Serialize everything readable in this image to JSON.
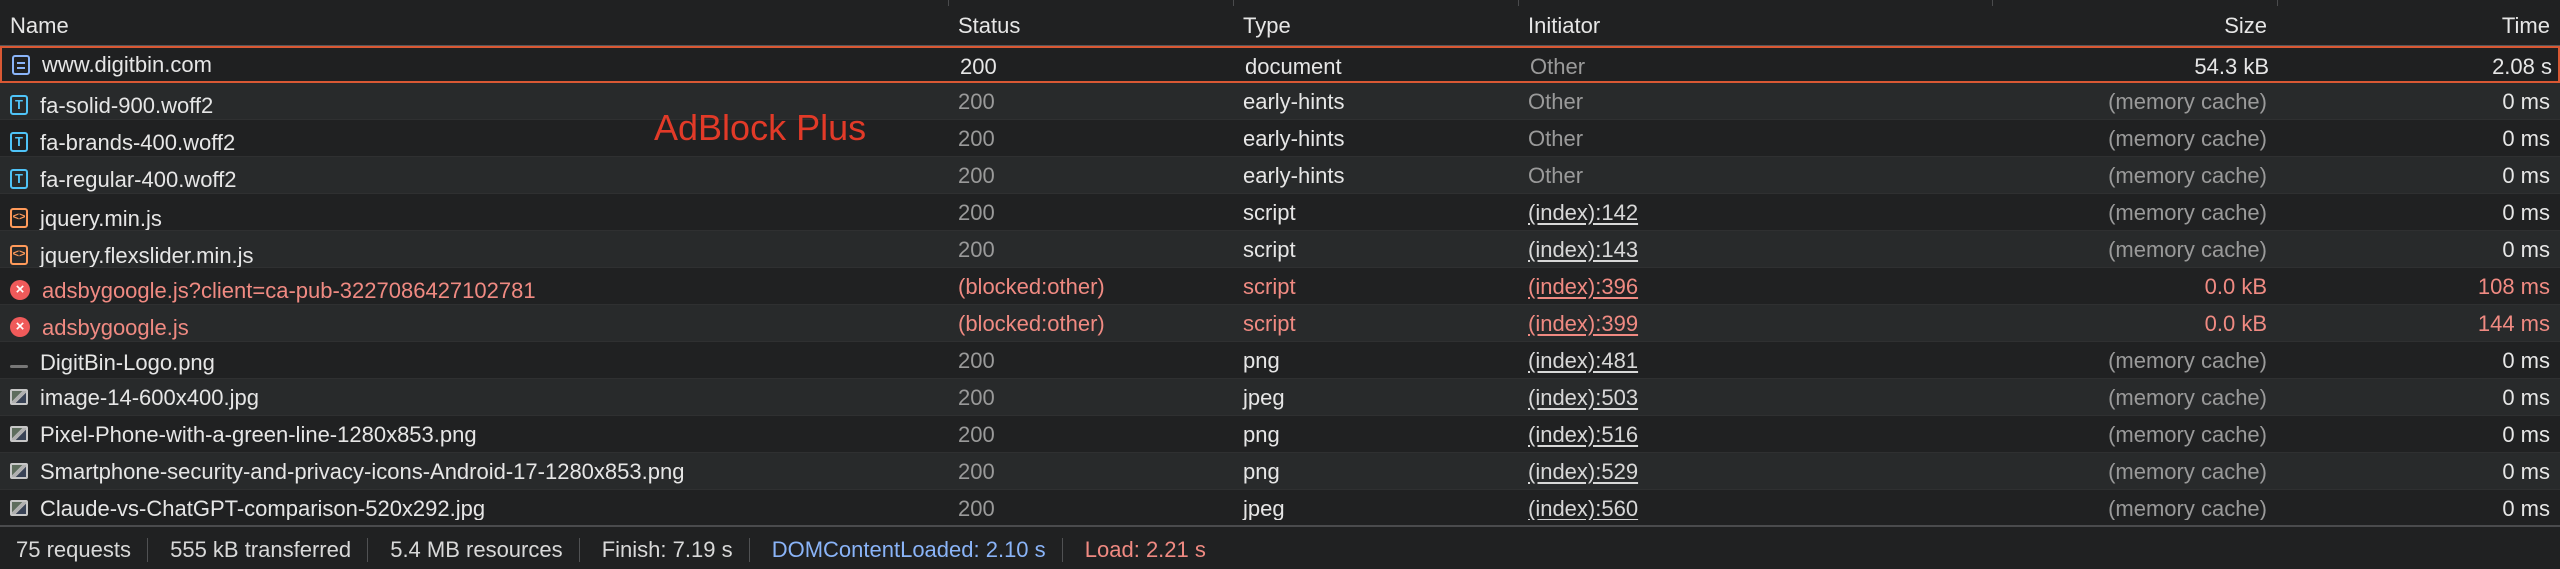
{
  "overlay_label": "AdBlock Plus",
  "colors": {
    "selected_border": "#d95834",
    "error_text": "#f08a82",
    "dom_content_loaded": "#8ab4f8",
    "load": "#f08a82",
    "overlay": "#e23a28"
  },
  "columns": {
    "name": "Name",
    "status": "Status",
    "type": "Type",
    "initiator": "Initiator",
    "size": "Size",
    "time": "Time"
  },
  "rows": [
    {
      "icon": "document-icon",
      "name": "www.digitbin.com",
      "status": "200",
      "type": "document",
      "initiator": "Other",
      "size": "54.3 kB",
      "time": "2.08 s"
    },
    {
      "icon": "font-icon",
      "icon_glyph": "T",
      "name": "fa-solid-900.woff2",
      "status": "200",
      "type": "early-hints",
      "initiator": "Other",
      "size": "(memory cache)",
      "time": "0 ms"
    },
    {
      "icon": "font-icon",
      "icon_glyph": "T",
      "name": "fa-brands-400.woff2",
      "status": "200",
      "type": "early-hints",
      "initiator": "Other",
      "size": "(memory cache)",
      "time": "0 ms"
    },
    {
      "icon": "font-icon",
      "icon_glyph": "T",
      "name": "fa-regular-400.woff2",
      "status": "200",
      "type": "early-hints",
      "initiator": "Other",
      "size": "(memory cache)",
      "time": "0 ms"
    },
    {
      "icon": "script-icon",
      "icon_glyph": "<>",
      "name": "jquery.min.js",
      "status": "200",
      "type": "script",
      "initiator": "(index):142",
      "size": "(memory cache)",
      "time": "0 ms"
    },
    {
      "icon": "script-icon",
      "icon_glyph": "<>",
      "name": "jquery.flexslider.min.js",
      "status": "200",
      "type": "script",
      "initiator": "(index):143",
      "size": "(memory cache)",
      "time": "0 ms"
    },
    {
      "icon": "error-icon",
      "icon_glyph": "×",
      "name": "adsbygoogle.js?client=ca-pub-3227086427102781",
      "status": "(blocked:other)",
      "type": "script",
      "initiator": "(index):396",
      "size": "0.0 kB",
      "time": "108 ms"
    },
    {
      "icon": "error-icon",
      "icon_glyph": "×",
      "name": "adsbygoogle.js",
      "status": "(blocked:other)",
      "type": "script",
      "initiator": "(index):399",
      "size": "0.0 kB",
      "time": "144 ms"
    },
    {
      "icon": "image-placeholder-icon",
      "name": "DigitBin-Logo.png",
      "status": "200",
      "type": "png",
      "initiator": "(index):481",
      "size": "(memory cache)",
      "time": "0 ms"
    },
    {
      "icon": "image-icon",
      "name": "image-14-600x400.jpg",
      "status": "200",
      "type": "jpeg",
      "initiator": "(index):503",
      "size": "(memory cache)",
      "time": "0 ms"
    },
    {
      "icon": "image-icon",
      "name": "Pixel-Phone-with-a-green-line-1280x853.png",
      "status": "200",
      "type": "png",
      "initiator": "(index):516",
      "size": "(memory cache)",
      "time": "0 ms"
    },
    {
      "icon": "image-icon",
      "name": "Smartphone-security-and-privacy-icons-Android-17-1280x853.png",
      "status": "200",
      "type": "png",
      "initiator": "(index):529",
      "size": "(memory cache)",
      "time": "0 ms"
    },
    {
      "icon": "image-icon",
      "name": "Claude-vs-ChatGPT-comparison-520x292.jpg",
      "status": "200",
      "type": "jpeg",
      "initiator": "(index):560",
      "size": "(memory cache)",
      "time": "0 ms"
    }
  ],
  "statusbar": {
    "requests": "75 requests",
    "transferred": "555 kB transferred",
    "resources": "5.4 MB resources",
    "finish": "Finish: 7.19 s",
    "dom_content_loaded": "DOMContentLoaded: 2.10 s",
    "load": "Load: 2.21 s"
  }
}
